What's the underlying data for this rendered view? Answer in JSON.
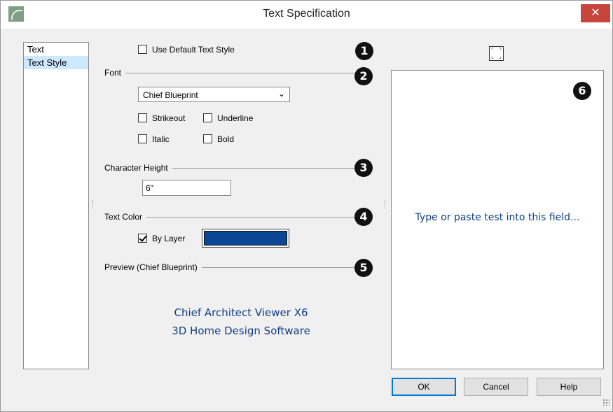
{
  "window": {
    "title": "Text Specification",
    "close_glyph": "✕"
  },
  "sidebar": {
    "items": [
      {
        "label": "Text"
      },
      {
        "label": "Text Style"
      }
    ],
    "selected": "Text Style"
  },
  "style": {
    "use_default_label": "Use Default Text Style",
    "use_default_checked": false,
    "font_section": "Font",
    "font_value": "Chief Blueprint",
    "strikeout_label": "Strikeout",
    "underline_label": "Underline",
    "italic_label": "Italic",
    "bold_label": "Bold",
    "height_section": "Character Height",
    "height_value": "6\"",
    "color_section": "Text Color",
    "by_layer_label": "By Layer",
    "by_layer_checked": true,
    "color_swatch": "#0a4694",
    "preview_section": "Preview (Chief Blueprint)",
    "preview_line1": "Chief Architect Viewer X6",
    "preview_line2": "3D Home Design Software"
  },
  "callouts": [
    "1",
    "2",
    "3",
    "4",
    "5",
    "6"
  ],
  "text_panel": {
    "placeholder": "Type or paste test into this field..."
  },
  "buttons": {
    "ok": "OK",
    "cancel": "Cancel",
    "help": "Help"
  },
  "icons": [
    "app-icon",
    "close-icon",
    "chevron-down-icon",
    "expand-icon",
    "resize-grip-icon"
  ],
  "colors": {
    "accent": "#0078d7",
    "close": "#c8453b",
    "text_blue": "#123f85"
  }
}
